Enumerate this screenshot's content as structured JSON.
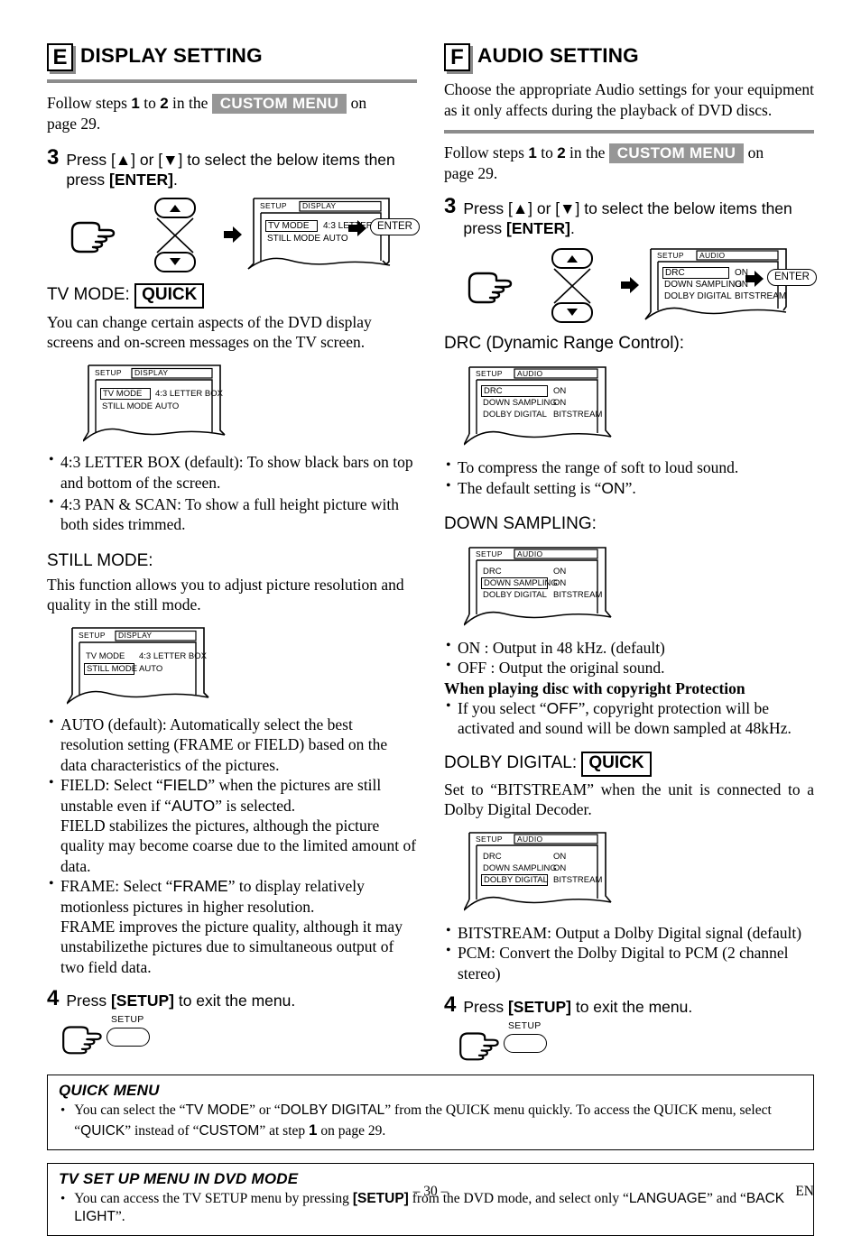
{
  "page": {
    "number": "– 30 –",
    "lang": "EN"
  },
  "left": {
    "letter": "E",
    "title": "DISPLAY SETTING",
    "intro_pre": "Follow steps",
    "intro_n1": "1",
    "intro_to": "to",
    "intro_n2": "2",
    "intro_in": "in the",
    "custom_menu": "CUSTOM MENU",
    "intro_on": "on",
    "intro_page": "page 29.",
    "step3_no": "3",
    "step3_a": "Press [",
    "step3_up": "▲",
    "step3_b": "] or [",
    "step3_dn": "▼",
    "step3_c": "] to select the below items then press ",
    "step3_enter": "[ENTER]",
    "step3_d": ".",
    "diagram": {
      "setup_label": "SETUP",
      "menu_tab": "DISPLAY",
      "row1_label": "TV MODE",
      "row1_value": "4:3 LETTER BOX",
      "row2_label": "STILL MODE",
      "row2_value": "AUTO",
      "highlight": "row1",
      "enter_label": "ENTER"
    },
    "tvmode": {
      "heading": "TV MODE:",
      "badge": "QUICK",
      "desc": "You can change certain aspects of the DVD display screens and on-screen messages on the TV screen.",
      "screen": {
        "setup_label": "SETUP",
        "menu_tab": "DISPLAY",
        "row1_label": "TV MODE",
        "row1_value": "4:3 LETTER BOX",
        "row2_label": "STILL MODE",
        "row2_value": "AUTO",
        "highlight": "row1"
      },
      "bullets": [
        "4:3 LETTER BOX (default): To show black bars on top and bottom of the screen.",
        "4:3 PAN & SCAN: To show a full height picture with both sides trimmed."
      ]
    },
    "stillmode": {
      "heading": "STILL MODE:",
      "desc": "This function allows you to adjust picture resolution and quality in the still mode.",
      "screen": {
        "setup_label": "SETUP",
        "menu_tab": "DISPLAY",
        "row1_label": "TV MODE",
        "row1_value": "4:3 LETTER BOX",
        "row2_label": "STILL MODE",
        "row2_value": "AUTO",
        "highlight": "row2"
      },
      "b1": "AUTO (default): Automatically select the best resolution setting (FRAME or FIELD) based on the data characteristics of the pictures.",
      "b2_p1": "FIELD: Select “",
      "b2_k1": "FIELD",
      "b2_p2": "” when the pictures are still unstable even if “",
      "b2_k2": "AUTO",
      "b2_p3": "” is selected.",
      "b2_p4": "FIELD stabilizes the pictures, although the picture quality may become coarse due to the limited amount of data.",
      "b3_p1": "FRAME: Select “",
      "b3_k1": "FRAME",
      "b3_p2": "” to display relatively motionless pictures in higher resolution.",
      "b3_p3": "FRAME improves the picture quality, although it may unstabilizethe pictures due to simultaneous output of two field data."
    },
    "step4_no": "4",
    "step4_a": "Press ",
    "step4_key": "[SETUP]",
    "step4_b": " to exit the menu.",
    "setup_key_label": "SETUP"
  },
  "right": {
    "letter": "F",
    "title": "AUDIO SETTING",
    "intro": "Choose the appropriate Audio settings for your equipment as it only affects during the playback of DVD discs.",
    "intro_pre": "Follow steps",
    "intro_n1": "1",
    "intro_to": "to",
    "intro_n2": "2",
    "intro_in": "in the",
    "custom_menu": "CUSTOM MENU",
    "intro_on": "on",
    "intro_page": "page 29.",
    "step3_no": "3",
    "step3_a": "Press [",
    "step3_up": "▲",
    "step3_b": "] or [",
    "step3_dn": "▼",
    "step3_c": "] to select the below items then press ",
    "step3_enter": "[ENTER]",
    "step3_d": ".",
    "diagram": {
      "setup_label": "SETUP",
      "menu_tab": "AUDIO",
      "row1_label": "DRC",
      "row1_value": "ON",
      "row2_label": "DOWN SAMPLING",
      "row2_value": "ON",
      "row3_label": "DOLBY DIGITAL",
      "row3_value": "BITSTREAM",
      "highlight": "row1",
      "enter_label": "ENTER"
    },
    "drc": {
      "heading": "DRC (Dynamic Range Control):",
      "screen": {
        "setup_label": "SETUP",
        "menu_tab": "AUDIO",
        "row1_label": "DRC",
        "row1_value": "ON",
        "row2_label": "DOWN SAMPLING",
        "row2_value": "ON",
        "row3_label": "DOLBY DIGITAL",
        "row3_value": "BITSTREAM",
        "highlight": "row1"
      },
      "b1": "To compress the range of soft to loud sound.",
      "b2_p1": "The default setting is “",
      "b2_k1": "ON",
      "b2_p2": "”."
    },
    "downsampling": {
      "heading": "DOWN SAMPLING:",
      "screen": {
        "setup_label": "SETUP",
        "menu_tab": "AUDIO",
        "row1_label": "DRC",
        "row1_value": "ON",
        "row2_label": "DOWN SAMPLING",
        "row2_value": "ON",
        "row3_label": "DOLBY DIGITAL",
        "row3_value": "BITSTREAM",
        "highlight": "row2"
      },
      "b1": "ON : Output in 48 kHz. (default)",
      "b2": "OFF : Output the original sound.",
      "bold": "When playing disc with copyright Protection",
      "b3_p1": "If you select “",
      "b3_k1": "OFF",
      "b3_p2": "”, copyright protection will be activated and sound will be down sampled at 48kHz."
    },
    "dolby": {
      "heading": "DOLBY DIGITAL:",
      "badge": "QUICK",
      "desc_p1": "Set to “BITSTREAM” when the unit is connected to a Dolby Digital Decoder.",
      "screen": {
        "setup_label": "SETUP",
        "menu_tab": "AUDIO",
        "row1_label": "DRC",
        "row1_value": "ON",
        "row2_label": "DOWN SAMPLING",
        "row2_value": "ON",
        "row3_label": "DOLBY DIGITAL",
        "row3_value": "BITSTREAM",
        "highlight": "row3"
      },
      "b1": "BITSTREAM: Output a Dolby Digital signal (default)",
      "b2": "PCM: Convert the Dolby Digital to PCM (2 channel stereo)"
    },
    "step4_no": "4",
    "step4_a": "Press ",
    "step4_key": "[SETUP]",
    "step4_b": " to exit the menu.",
    "setup_key_label": "SETUP"
  },
  "notes": {
    "quick": {
      "title": "QUICK MENU",
      "bullet": "•",
      "t1": "You can select the “",
      "k1": "TV MODE",
      "t2": "” or “",
      "k2": "DOLBY DIGITAL",
      "t3": "” from the QUICK menu quickly. To access the QUICK menu, select “",
      "k3": "QUICK",
      "t4": "” instead of “",
      "k4": "CUSTOM",
      "t5": "” at step ",
      "k5": "1",
      "t6": " on page 29."
    },
    "tvsetup": {
      "title": "TV SET UP MENU IN DVD MODE",
      "bullet": "•",
      "t1": "You can access the TV SETUP menu by pressing ",
      "k1": "[SETUP]",
      "t2": " from the DVD mode, and select only “",
      "k2": "LANGUAGE",
      "t3": "” and “",
      "k3": "BACK LIGHT",
      "t4": "”."
    }
  }
}
